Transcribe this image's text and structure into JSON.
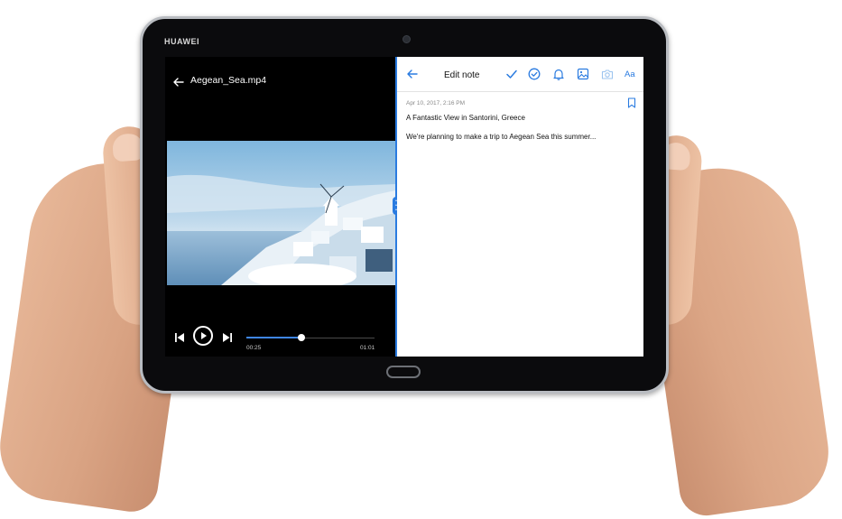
{
  "device": {
    "brand": "HUAWEI"
  },
  "video_player": {
    "title": "Aegean_Sea.mp4",
    "elapsed": "00:25",
    "total": "01:01",
    "progress": 0.43,
    "icons": {
      "back": "arrow-left-icon",
      "previous": "skip-previous-icon",
      "play": "play-icon",
      "next": "skip-next-icon"
    }
  },
  "note_editor": {
    "title": "Edit note",
    "date": "Apr 10, 2017, 2:16 PM",
    "heading": "A Fantastic View in Santorini, Greece",
    "body": "We're planning to make a trip to Aegean Sea this summer...",
    "font_button": "Aa",
    "toolbar_icons": [
      "check-icon",
      "checklist-icon",
      "bell-icon",
      "image-icon",
      "camera-icon"
    ],
    "accent_color": "#2a7be0"
  }
}
